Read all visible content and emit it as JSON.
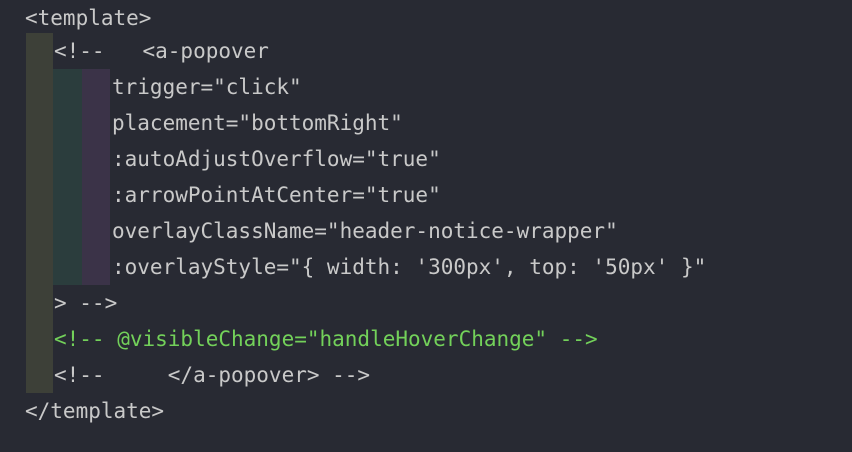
{
  "editor": {
    "colors": {
      "background": "#282a33",
      "text": "#c9c9c9",
      "comment_green": "#73d15a",
      "indent_guide_1": "#3d4038",
      "indent_guide_2": "#2b3d3d",
      "indent_guide_3": "#3b3348"
    },
    "lines": [
      "<template>",
      "<!--   <a-popover",
      "trigger=\"click\"",
      "placement=\"bottomRight\"",
      ":autoAdjustOverflow=\"true\"",
      ":arrowPointAtCenter=\"true\"",
      "overlayClassName=\"header-notice-wrapper\"",
      ":overlayStyle=\"{ width: '300px', top: '50px' }\"",
      "> -->",
      "<!-- @visibleChange=\"handleHoverChange\" -->",
      "<!--     </a-popover> -->",
      "</template>"
    ]
  }
}
